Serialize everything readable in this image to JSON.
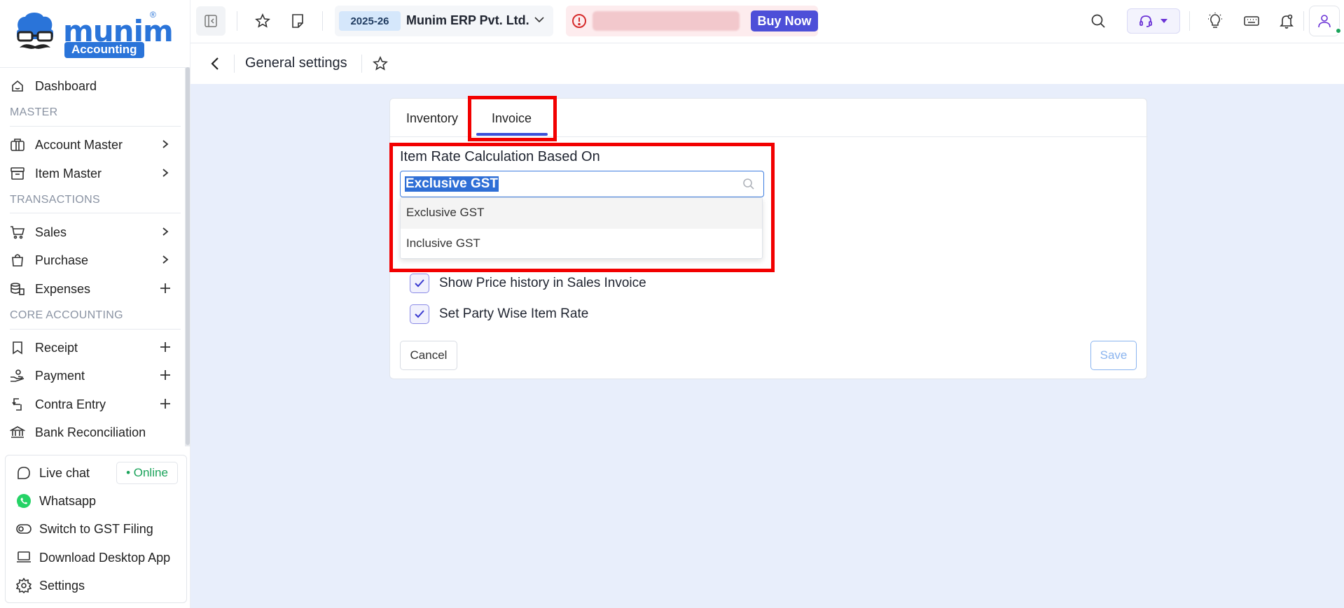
{
  "brand": {
    "logo_word": "munim",
    "logo_badge": "Accounting",
    "logo_reg": "®"
  },
  "sidebar": {
    "items": [
      {
        "label": "Dashboard",
        "icon": "home-icon"
      },
      {
        "label": "Account Master",
        "icon": "briefcase-icon",
        "trail": "chevron-right-icon"
      },
      {
        "label": "Item Master",
        "icon": "archive-icon",
        "trail": "chevron-right-icon"
      },
      {
        "label": "Sales",
        "icon": "cart-icon",
        "trail": "chevron-right-icon"
      },
      {
        "label": "Purchase",
        "icon": "bag-icon",
        "trail": "chevron-right-icon"
      },
      {
        "label": "Expenses",
        "icon": "expenses-icon",
        "trail": "plus-icon"
      },
      {
        "label": "Receipt",
        "icon": "receipt-icon",
        "trail": "plus-icon"
      },
      {
        "label": "Payment",
        "icon": "payment-hand-icon",
        "trail": "plus-icon"
      },
      {
        "label": "Contra Entry",
        "icon": "contra-icon",
        "trail": "plus-icon"
      },
      {
        "label": "Bank Reconciliation",
        "icon": "bank-icon"
      }
    ],
    "sections": {
      "master": "MASTER",
      "transactions": "TRANSACTIONS",
      "core_accounting": "CORE ACCOUNTING"
    },
    "bottom": {
      "live_chat": "Live chat",
      "online_badge": "• Online",
      "whatsapp": "Whatsapp",
      "switch_gst": "Switch to GST Filing",
      "download_app": "Download Desktop App",
      "settings": "Settings"
    }
  },
  "topbar": {
    "fiscal_year": "2025-26",
    "company": "Munim ERP Pvt. Ltd.",
    "buy_now": "Buy Now"
  },
  "page": {
    "title": "General settings"
  },
  "tabs": [
    {
      "label": "Inventory",
      "selected": false
    },
    {
      "label": "Invoice",
      "selected": true
    }
  ],
  "form": {
    "field_label": "Item Rate Calculation Based On",
    "selected_value": "Exclusive GST",
    "options": [
      "Exclusive GST",
      "Inclusive GST"
    ],
    "checkboxes": [
      {
        "label": "Show Price history in Sales Invoice",
        "checked": true
      },
      {
        "label": "Set Party Wise Item Rate",
        "checked": true
      }
    ],
    "cancel": "Cancel",
    "save": "Save"
  },
  "colors": {
    "brand_blue": "#2a74d9",
    "accent_indigo": "#4d4fd8",
    "highlight_red": "#f20000",
    "online_green": "#1aa35a",
    "main_bg": "#e8eefb"
  }
}
